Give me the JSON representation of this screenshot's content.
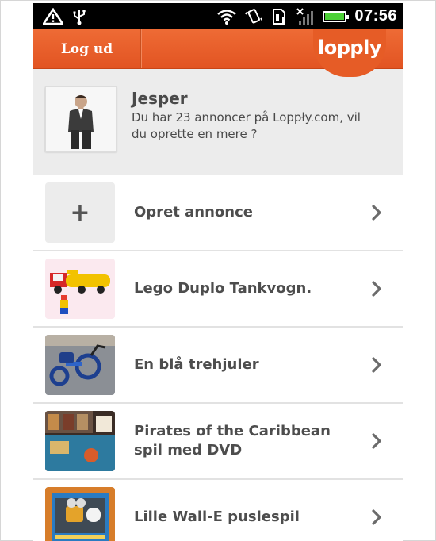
{
  "status_bar": {
    "time": "07:56",
    "icons": [
      "warning-icon",
      "usb-icon",
      "wifi-icon",
      "vibrate-icon",
      "sd-card-icon",
      "no-signal-icon",
      "battery-icon"
    ]
  },
  "header": {
    "logout_label": "Log ud",
    "logo_text": "lopply",
    "accent_color": "#e65c26"
  },
  "profile": {
    "name": "Jesper",
    "message": "Du har 23 annoncer på Loppły.com, vil du oprette en mere ?"
  },
  "list": {
    "items": [
      {
        "title": "Opret annonce",
        "thumb": "add-icon"
      },
      {
        "title": "Lego Duplo Tankvogn.",
        "thumb": "lego-truck-photo"
      },
      {
        "title": "En blå trehjuler",
        "thumb": "tricycle-photo"
      },
      {
        "title": "Pirates of the Caribbean spil med DVD",
        "thumb": "board-game-photo"
      },
      {
        "title": "Lille Wall-E puslespil",
        "thumb": "puzzle-photo"
      }
    ]
  }
}
